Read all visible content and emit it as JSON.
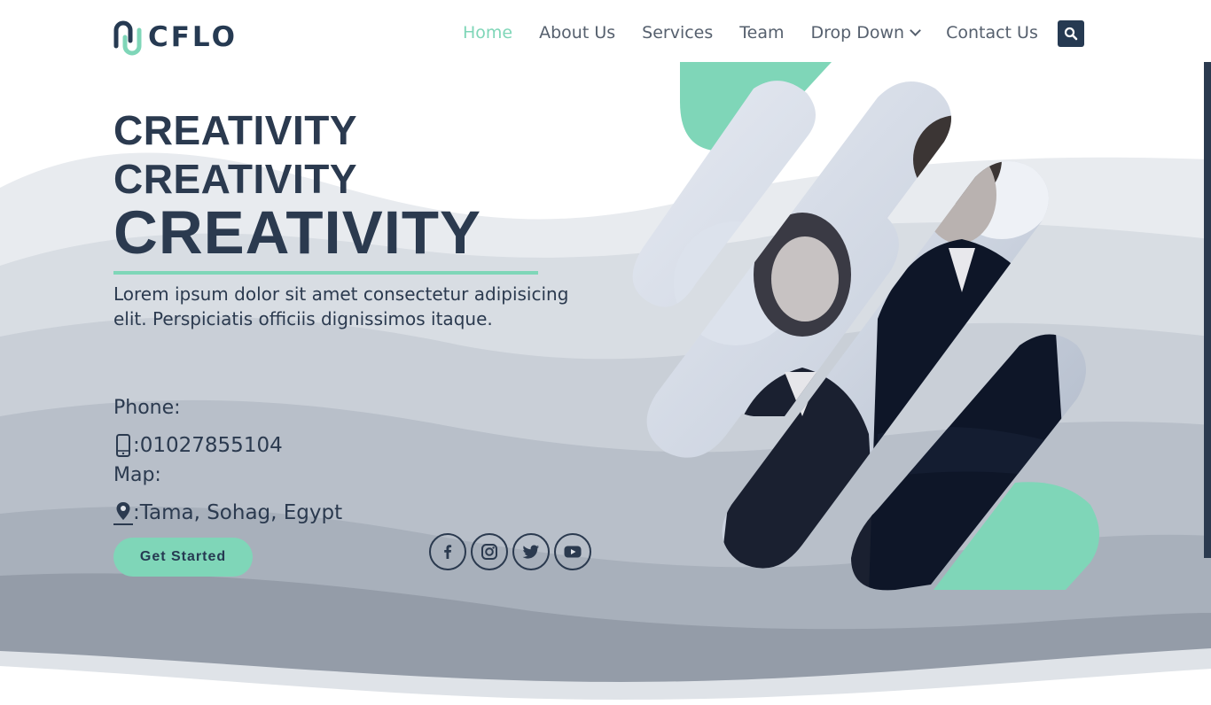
{
  "brand": {
    "logo_text": "CFLO",
    "accent_color": "#7fd6b8",
    "dark_color": "#263a52"
  },
  "nav": {
    "items": [
      {
        "label": "Home",
        "active": true
      },
      {
        "label": "About Us"
      },
      {
        "label": "Services"
      },
      {
        "label": "Team"
      },
      {
        "label": "Drop Down",
        "has_caret": true
      },
      {
        "label": "Contact Us"
      }
    ],
    "search_icon": "search-icon"
  },
  "hero": {
    "line1": "CREATIVITY",
    "line2": "CREATIVITY",
    "line3": "CREATIVITY",
    "lead": "Lorem ipsum dolor sit amet consectetur adipisicing elit. Perspiciatis officiis dignissimos itaque."
  },
  "contact": {
    "phone_label": "Phone:",
    "phone_value": ":01027855104",
    "phone_icon": "mobile-phone-icon",
    "map_label": "Map:",
    "map_value": ":Tama, Sohag, Egypt",
    "map_icon": "map-marker-icon"
  },
  "cta": {
    "label": "Get Started"
  },
  "social": [
    {
      "icon": "facebook-icon"
    },
    {
      "icon": "instagram-icon"
    },
    {
      "icon": "twitter-icon"
    },
    {
      "icon": "youtube-icon"
    }
  ]
}
